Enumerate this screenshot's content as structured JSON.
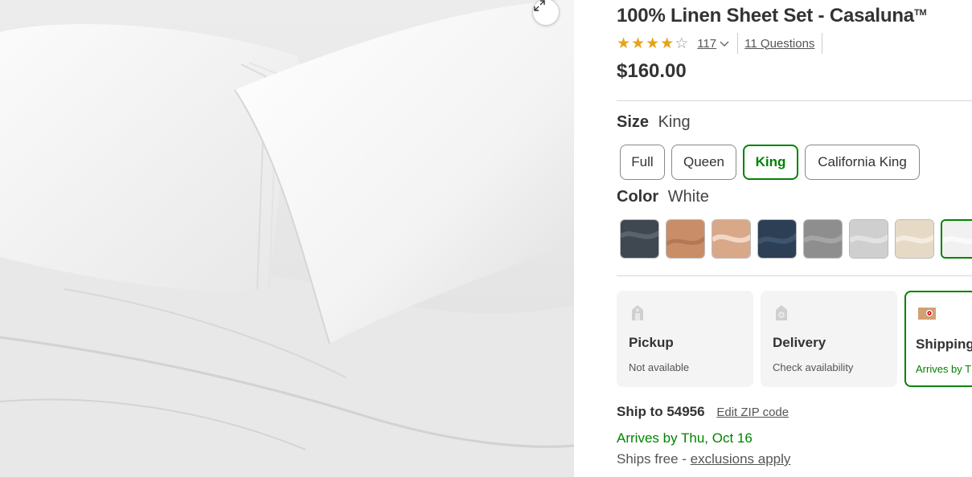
{
  "product": {
    "title": "100% Linen Sheet Set - Casaluna",
    "trademark": "TM",
    "rating": 4,
    "review_count": "117",
    "questions_label": "11 Questions",
    "price": "$160.00"
  },
  "size": {
    "label": "Size",
    "selected": "King",
    "options": [
      "Full",
      "Queen",
      "King",
      "California King"
    ]
  },
  "color": {
    "label": "Color",
    "selected": "White",
    "swatches": [
      "#3f4850",
      "#c98e68",
      "#d9a889",
      "#2c3f55",
      "#8e8e8e",
      "#cfcfcf",
      "#e6dac7",
      "#f1f1f1"
    ]
  },
  "fulfillment": [
    {
      "name": "Pickup",
      "status": "Not available",
      "icon": "store-icon"
    },
    {
      "name": "Delivery",
      "status": "Check availability",
      "icon": "store-icon"
    },
    {
      "name": "Shipping",
      "status": "Arrives by Thu",
      "icon": "box-icon"
    }
  ],
  "shipping": {
    "ship_to_label": "Ship to 54956",
    "edit_zip_label": "Edit ZIP code",
    "arrives": "Arrives by Thu, Oct 16",
    "ships_free_prefix": "Ships free - ",
    "exclusions_label": "exclusions apply"
  },
  "colors": {
    "accent_green": "#008300",
    "star": "#e8a317",
    "text": "#333333"
  }
}
